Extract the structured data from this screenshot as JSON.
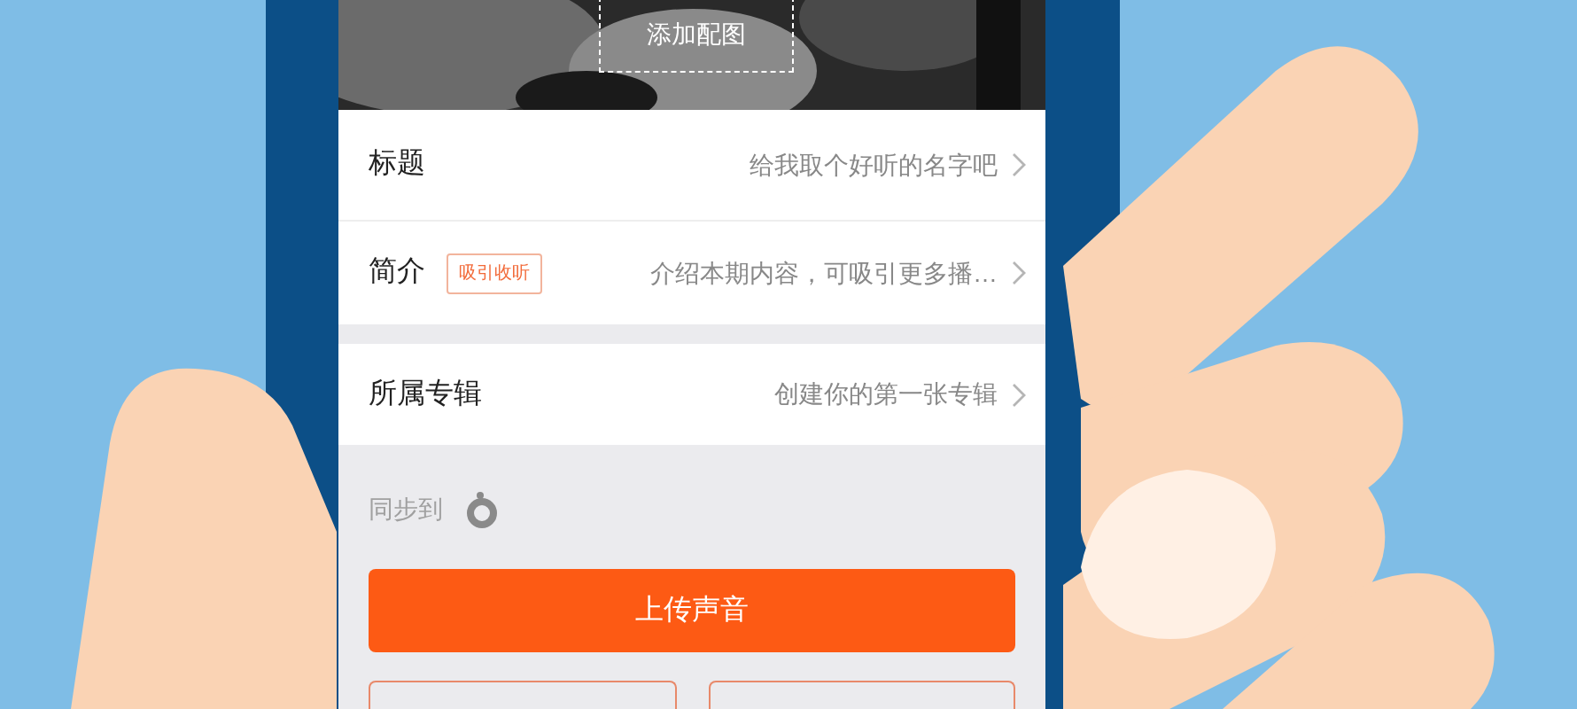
{
  "cover": {
    "kind": "picture",
    "label": "添加配图"
  },
  "rows": [
    {
      "label": "标题",
      "value": "给我取个好听的名字吧"
    },
    {
      "label": "简介",
      "badge": "吸引收听",
      "value": "介绍本期内容，可吸引更多播…"
    },
    {
      "label": "所属专辑",
      "value": "创建你的第一张专辑"
    }
  ],
  "sync": {
    "label": "同步到"
  },
  "primary_button": "上传声音"
}
